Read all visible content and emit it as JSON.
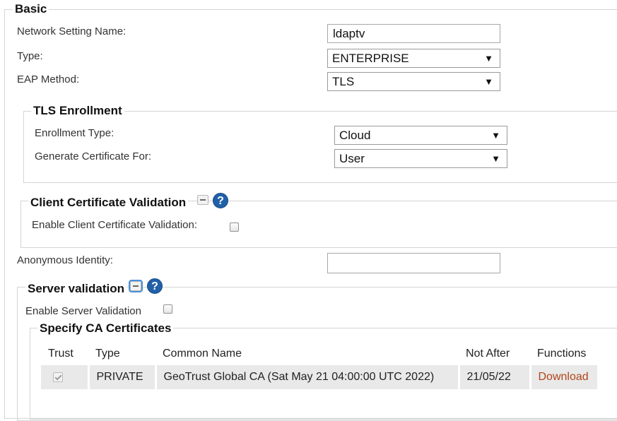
{
  "basic": {
    "legend": "Basic",
    "network_setting_name": {
      "label": "Network Setting Name:",
      "value": "ldaptv"
    },
    "type": {
      "label": "Type:",
      "value": "ENTERPRISE"
    },
    "eap_method": {
      "label": "EAP Method:",
      "value": "TLS"
    }
  },
  "tls_enrollment": {
    "legend": "TLS Enrollment",
    "enrollment_type": {
      "label": "Enrollment Type:",
      "value": "Cloud"
    },
    "generate_certificate_for": {
      "label": "Generate Certificate For:",
      "value": "User"
    }
  },
  "client_cert_validation": {
    "legend": "Client Certificate Validation",
    "enable_label": "Enable Client Certificate Validation:",
    "enabled": false
  },
  "anonymous_identity": {
    "label": "Anonymous Identity:",
    "value": ""
  },
  "server_validation": {
    "legend": "Server validation",
    "enable_label": "Enable Server Validation",
    "enabled": false,
    "ca_certificates": {
      "legend": "Specify CA Certificates",
      "columns": [
        "Trust",
        "Type",
        "Common Name",
        "Not After",
        "Functions"
      ],
      "rows": [
        {
          "trust": true,
          "type": "PRIVATE",
          "common_name": "GeoTrust Global CA (Sat May 21 04:00:00 UTC 2022)",
          "not_after": "21/05/22",
          "function": "Download"
        }
      ]
    }
  },
  "icons": {
    "arrow": "▼",
    "help": "?"
  }
}
